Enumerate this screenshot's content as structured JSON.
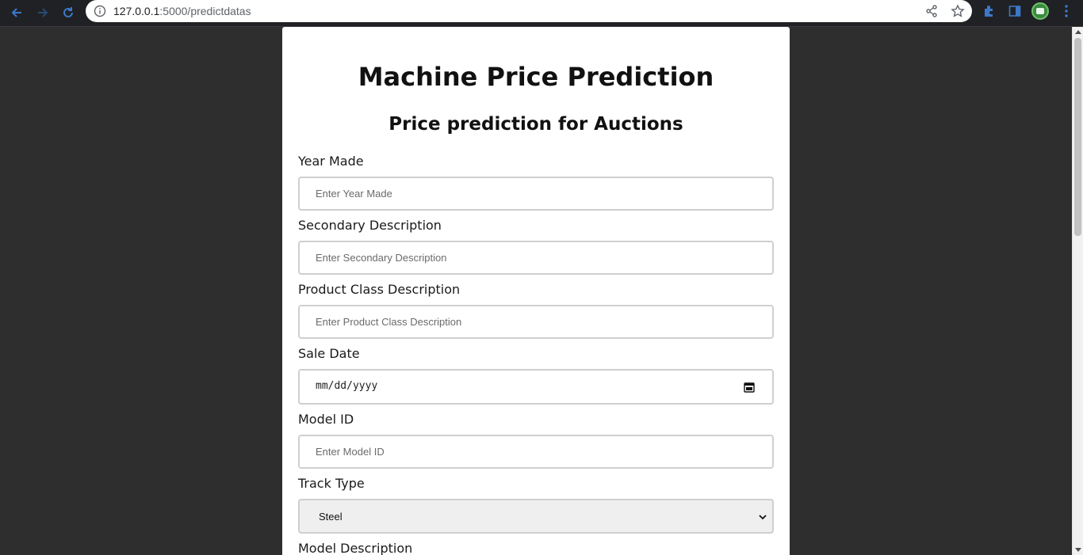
{
  "browser": {
    "url_host": "127.0.0.1",
    "url_path": ":5000/predictdatas",
    "icons": [
      "back-icon",
      "forward-icon",
      "reload-icon",
      "site-info-icon",
      "share-icon",
      "bookmark-star-icon",
      "extensions-icon",
      "side-panel-icon",
      "profile-avatar",
      "menu-icon"
    ]
  },
  "page": {
    "title": "Machine Price Prediction",
    "subtitle": "Price prediction for Auctions",
    "fields": {
      "year_made": {
        "label": "Year Made",
        "placeholder": "Enter Year Made"
      },
      "secondary_description": {
        "label": "Secondary Description",
        "placeholder": "Enter Secondary Description"
      },
      "product_class_description": {
        "label": "Product Class Description",
        "placeholder": "Enter Product Class Description"
      },
      "sale_date": {
        "label": "Sale Date",
        "mask": "mm/dd/yyyy"
      },
      "model_id": {
        "label": "Model ID",
        "placeholder": "Enter Model ID"
      },
      "track_type": {
        "label": "Track Type",
        "selected": "Steel"
      },
      "model_description": {
        "label": "Model Description"
      }
    }
  },
  "colors": {
    "page_background": "#2e2e2e",
    "card_background": "#ffffff",
    "chrome_background": "#202124",
    "nav_icon_blue": "#3c78c8"
  }
}
